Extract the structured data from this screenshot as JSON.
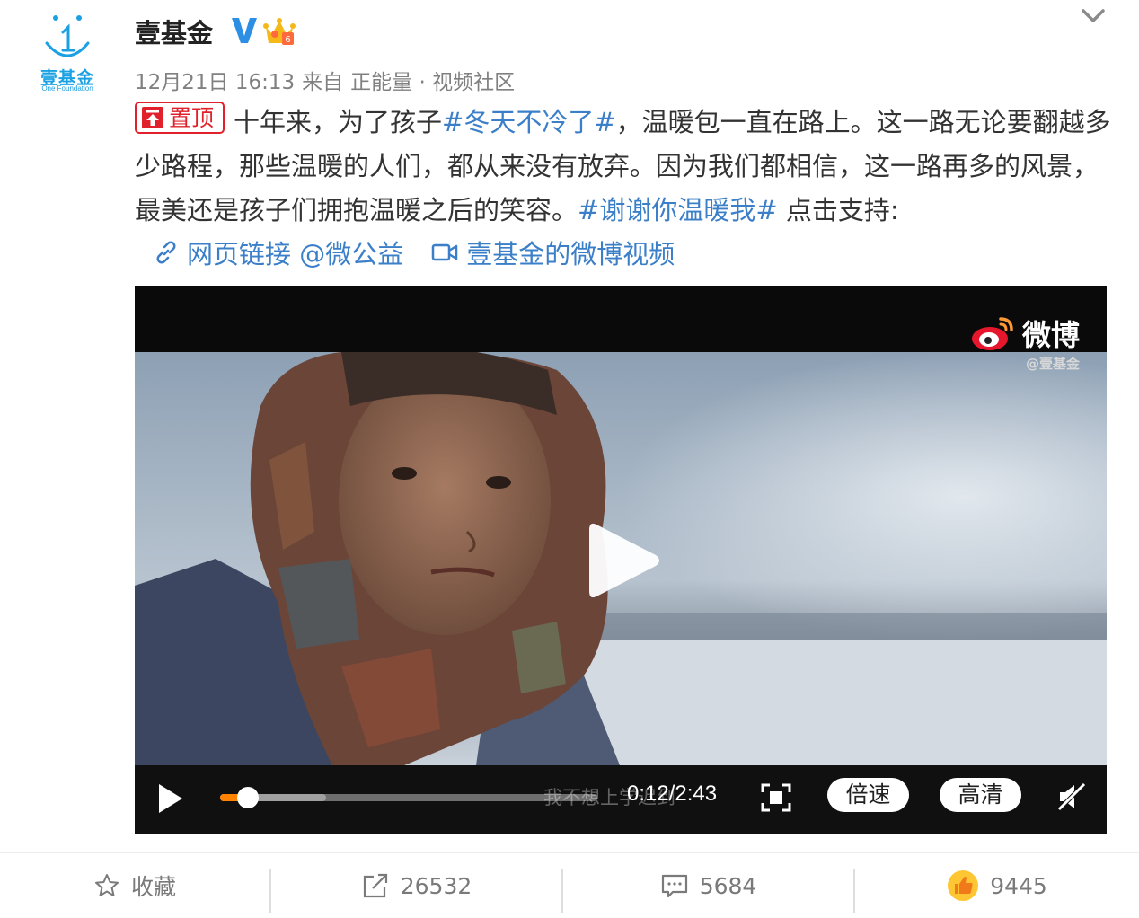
{
  "account": {
    "name": "壹基金",
    "logo_text": "壹基金",
    "logo_subtext": "One Foundation",
    "verified_badge": "V",
    "vip_icon": "crown-icon"
  },
  "meta": {
    "date": "12月21日 16:13",
    "source_prefix": "来自",
    "source": "正能量 · 视频社区"
  },
  "post": {
    "pin_label": "置顶",
    "text_1": "十年来，为了孩子",
    "topic_1": "#冬天不冷了#",
    "text_2": "，温暖包一直在路上。这一路无论要翻越多少路程，那些温暖的人们，都从来没有放弃。因为我们都相信，这一路再多的风景，最美还是孩子们拥抱温暖之后的笑容。",
    "topic_2": "#谢谢你温暖我#",
    "text_3": " 点击支持:"
  },
  "links": {
    "web_link": "网页链接 @微公益",
    "video_link": "壹基金的微博视频"
  },
  "video": {
    "watermark": "微博",
    "watermark_sub": "@壹基金",
    "subtitle": "我不想上学迟到",
    "current_time": "0:12",
    "duration": "2:43",
    "time_display": "0:12/2:43",
    "progress": 0.074,
    "buffered": 0.28,
    "speed_label": "倍速",
    "quality_label": "高清",
    "accent_color": "#ff8200"
  },
  "actions": {
    "favorite_label": "收藏",
    "repost_count": "26532",
    "comment_count": "5684",
    "like_count": "9445"
  }
}
